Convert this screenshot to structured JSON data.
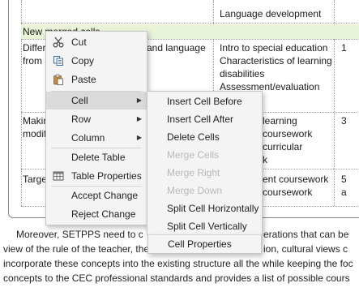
{
  "table": {
    "row0_col2": "Language development",
    "merged_label": "New merged cells",
    "row1": {
      "col0_line1": "Differe",
      "col0_line2": "from a",
      "col1": "and language",
      "col2_lines": [
        "Intro to special education",
        "Characteristics of learning",
        "disabilities",
        "Assessment/evaluation"
      ],
      "col3": "1"
    },
    "row2": {
      "col0_line1": "Makin",
      "col0_line2": "modifi",
      "col2_lines": [
        "learning",
        "coursework",
        "curricular",
        "k"
      ],
      "col3": "3"
    },
    "row3": {
      "col0": "Target",
      "col2_lines": [
        "ent coursework",
        "coursework"
      ],
      "col3_line1": "5",
      "col3_line2": "a"
    }
  },
  "paragraph": {
    "line1_left": "Moreover, SETPPS need to c",
    "line1_right": "erations that can be",
    "line2_left": "view of the rule of the teacher, the",
    "line2_right": "ion, cultural views c",
    "line3": "incorporate these concepts into the existing structure all the while keeping the foc",
    "line4": "concepts to the CEC professional standards and provides a list of possible cours"
  },
  "context_menu": {
    "items": [
      {
        "label": "Cut",
        "icon": "scissors-icon"
      },
      {
        "label": "Copy",
        "icon": "copy-icon"
      },
      {
        "label": "Paste",
        "icon": "paste-icon"
      },
      {
        "label": "Cell",
        "submenu": true
      },
      {
        "label": "Row",
        "submenu": true
      },
      {
        "label": "Column",
        "submenu": true
      },
      {
        "label": "Delete Table"
      },
      {
        "label": "Table Properties",
        "icon": "table-icon"
      },
      {
        "label": "Accept Change"
      },
      {
        "label": "Reject Change"
      }
    ],
    "submenu_arrow": "▶"
  },
  "cell_submenu": {
    "items": [
      {
        "label": "Insert Cell Before",
        "enabled": true
      },
      {
        "label": "Insert Cell After",
        "enabled": true
      },
      {
        "label": "Delete Cells",
        "enabled": true
      },
      {
        "label": "Merge Cells",
        "enabled": false
      },
      {
        "label": "Merge Right",
        "enabled": false
      },
      {
        "label": "Merge Down",
        "enabled": false
      },
      {
        "label": "Split Cell Horizontally",
        "enabled": true
      },
      {
        "label": "Split Cell Vertically",
        "enabled": true
      },
      {
        "label": "Cell Properties",
        "enabled": true
      }
    ]
  },
  "colors": {
    "merged_highlight": "#e8f3d8",
    "menu_bg": "#f4f4f4",
    "active_item": "#dadada",
    "disabled_text": "#b9b9b9"
  }
}
